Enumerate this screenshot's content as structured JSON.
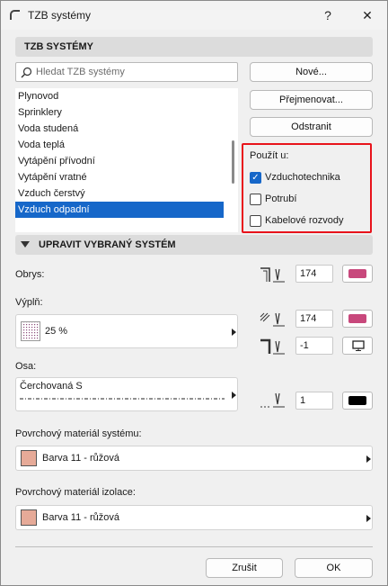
{
  "window": {
    "title": "TZB systémy",
    "help": "?",
    "close": "✕"
  },
  "header1": "TZB SYSTÉMY",
  "search": {
    "placeholder": "Hledat TZB systémy"
  },
  "systems": [
    "Plynovod",
    "Sprinklery",
    "Voda studená",
    "Voda teplá",
    "Vytápění přívodní",
    "Vytápění vratné",
    "Vzduch čerstvý",
    "Vzduch odpadní"
  ],
  "selected_index": 7,
  "buttons": {
    "new": "Nové...",
    "rename": "Přejmenovat...",
    "delete": "Odstranit"
  },
  "used_in": {
    "title": "Použít u:",
    "options": [
      {
        "label": "Vzduchotechnika",
        "checked": true
      },
      {
        "label": "Potrubí",
        "checked": false
      },
      {
        "label": "Kabelové rozvody",
        "checked": false
      }
    ]
  },
  "header2": "UPRAVIT VYBRANÝ SYSTÉM",
  "outline": {
    "label": "Obrys:",
    "pen": "174",
    "color": "#c8487c"
  },
  "fill": {
    "label": "Výplň:",
    "value": "25 %",
    "pen": "174",
    "color": "#c8487c",
    "bg_pen": "-1"
  },
  "axis": {
    "label": "Osa:",
    "value": "Čerchovaná S",
    "pen": "1",
    "color": "#000000"
  },
  "surface_system": {
    "label": "Povrchový materiál systému:",
    "value": "Barva 11 - růžová",
    "color": "#e6aa98"
  },
  "surface_insulation": {
    "label": "Povrchový materiál izolace:",
    "value": "Barva 11 - růžová",
    "color": "#e6aa98"
  },
  "footer": {
    "cancel": "Zrušit",
    "ok": "OK"
  }
}
